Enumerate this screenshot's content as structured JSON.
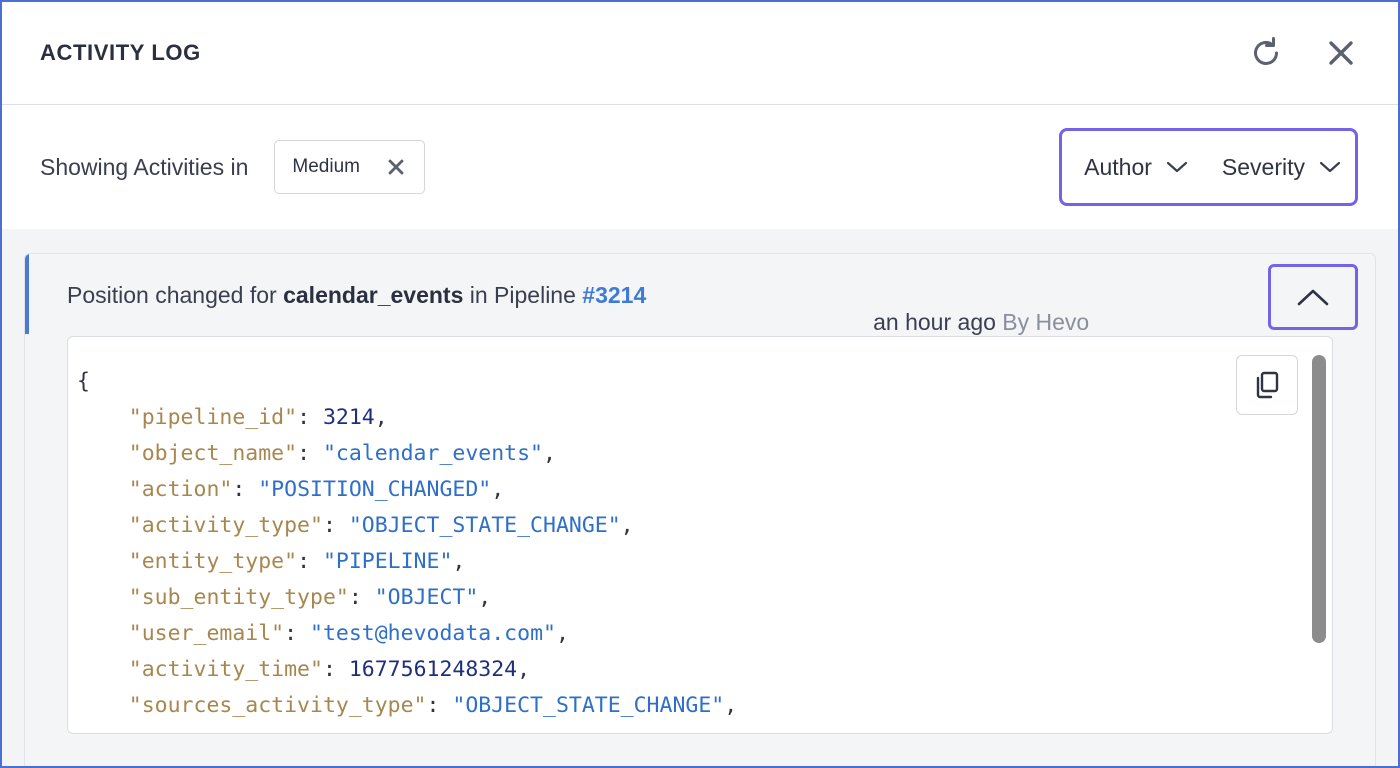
{
  "header": {
    "title": "ACTIVITY LOG",
    "refresh_icon": "refresh-icon",
    "close_icon": "close-icon"
  },
  "filters": {
    "showing_label": "Showing Activities in",
    "active_chip": "Medium",
    "author_label": "Author",
    "severity_label": "Severity"
  },
  "activity": {
    "prefix": "Position changed for ",
    "object_name": "calendar_events",
    "middle": " in Pipeline ",
    "pipeline_ref": "#3214",
    "time": "an hour ago",
    "author": "By Hevo",
    "json_lines": [
      {
        "indent": false,
        "punct": "{"
      },
      {
        "key": "\"pipeline_id\"",
        "value": "3214",
        "vtype": "number",
        "punct": ","
      },
      {
        "key": "\"object_name\"",
        "value": "\"calendar_events\"",
        "vtype": "string",
        "punct": ","
      },
      {
        "key": "\"action\"",
        "value": "\"POSITION_CHANGED\"",
        "vtype": "string",
        "punct": ","
      },
      {
        "key": "\"activity_type\"",
        "value": "\"OBJECT_STATE_CHANGE\"",
        "vtype": "string",
        "punct": ","
      },
      {
        "key": "\"entity_type\"",
        "value": "\"PIPELINE\"",
        "vtype": "string",
        "punct": ","
      },
      {
        "key": "\"sub_entity_type\"",
        "value": "\"OBJECT\"",
        "vtype": "string",
        "punct": ","
      },
      {
        "key": "\"user_email\"",
        "value": "\"test@hevodata.com\"",
        "vtype": "string",
        "punct": ","
      },
      {
        "key": "\"activity_time\"",
        "value": "1677561248324",
        "vtype": "number",
        "punct": ","
      },
      {
        "key": "\"sources_activity_type\"",
        "value": "\"OBJECT_STATE_CHANGE\"",
        "vtype": "string",
        "punct": ","
      }
    ]
  },
  "colors": {
    "accent": "#7363e8",
    "link": "#3f7bd6",
    "json_key": "#a8874f",
    "json_string": "#2f6fc9",
    "json_number": "#1f2f7a"
  }
}
